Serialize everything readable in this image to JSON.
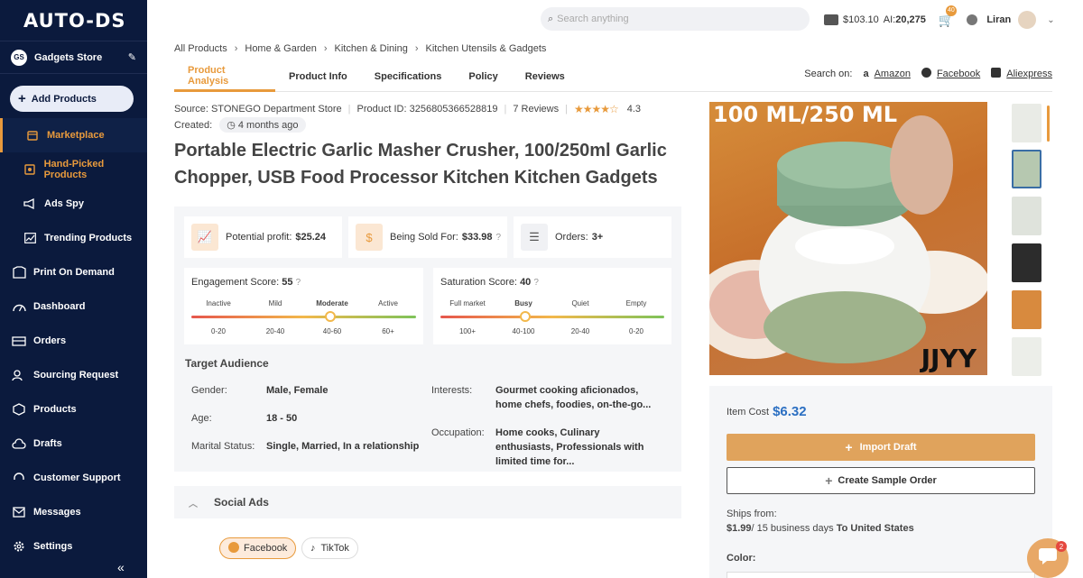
{
  "sidebar": {
    "logo": "AUTO-DS",
    "store_initials": "GS",
    "store_name": "Gadgets Store",
    "add_products": "Add Products",
    "items": [
      {
        "label": "Marketplace",
        "icon": "marketplace-icon",
        "active": true
      },
      {
        "label": "Hand-Picked Products",
        "icon": "hand-picked-icon"
      },
      {
        "label": "Ads Spy",
        "icon": "megaphone-icon"
      },
      {
        "label": "Trending Products",
        "icon": "trend-icon"
      },
      {
        "label": "Print On Demand",
        "icon": "print-icon"
      },
      {
        "label": "Dashboard",
        "icon": "dashboard-icon"
      },
      {
        "label": "Orders",
        "icon": "orders-icon"
      },
      {
        "label": "Sourcing Request",
        "icon": "sourcing-icon"
      },
      {
        "label": "Products",
        "icon": "box-icon"
      },
      {
        "label": "Drafts",
        "icon": "cloud-icon"
      },
      {
        "label": "Customer Support",
        "icon": "headset-icon"
      },
      {
        "label": "Messages",
        "icon": "mail-icon"
      },
      {
        "label": "Settings",
        "icon": "gear-icon"
      }
    ],
    "collapse": "«"
  },
  "topbar": {
    "search_placeholder": "Search anything",
    "balance": "$103.10",
    "ai_label": "AI:",
    "ai_credits": "20,275",
    "cart_badge": "40",
    "user": "Liran"
  },
  "breadcrumb": [
    "All Products",
    "Home & Garden",
    "Kitchen & Dining",
    "Kitchen Utensils & Gadgets"
  ],
  "tabs": [
    "Product Analysis",
    "Product Info",
    "Specifications",
    "Policy",
    "Reviews"
  ],
  "search_on": {
    "label": "Search on:",
    "links": [
      "Amazon",
      "Facebook",
      "Aliexpress"
    ]
  },
  "product": {
    "source": "Source: STONEGO Department Store",
    "product_id": "Product ID: 3256805366528819",
    "reviews": "7 Reviews",
    "stars": "★★★★☆",
    "rating": "4.3",
    "created_label": "Created:",
    "created_value": "4 months ago",
    "title": "Portable Electric Garlic Masher Crusher, 100/250ml Garlic Chopper, USB Food Processor Kitchen Kitchen Gadgets"
  },
  "stats": {
    "profit_label": "Potential profit:",
    "profit_value": "$25.24",
    "sold_label": "Being Sold For:",
    "sold_value": "$33.98",
    "orders_label": "Orders:",
    "orders_value": "3+"
  },
  "engagement": {
    "label": "Engagement Score:",
    "value": "55",
    "levels": [
      "Inactive",
      "Mild",
      "Moderate",
      "Active"
    ],
    "ranges": [
      "0-20",
      "20-40",
      "40-60",
      "60+"
    ],
    "position": 0.62
  },
  "saturation": {
    "label": "Saturation Score:",
    "value": "40",
    "levels": [
      "Full market",
      "Busy",
      "Quiet",
      "Empty"
    ],
    "ranges": [
      "100+",
      "40-100",
      "20-40",
      "0-20"
    ],
    "position": 0.38
  },
  "audience": {
    "title": "Target Audience",
    "gender_label": "Gender:",
    "gender": "Male, Female",
    "age_label": "Age:",
    "age": "18 - 50",
    "marital_label": "Marital Status:",
    "marital": "Single, Married, In a relationship",
    "interests_label": "Interests:",
    "interests": "Gourmet cooking aficionados, home chefs, foodies, on-the-go...",
    "occupation_label": "Occupation:",
    "occupation": "Home cooks, Culinary enthusiasts, Professionals with limited time for..."
  },
  "social": {
    "title": "Social Ads",
    "facebook": "Facebook",
    "tiktok": "TikTok"
  },
  "gallery": {
    "overlay_text": "100 ML/250 ML",
    "brand": "JJYY"
  },
  "buy": {
    "cost_label": "Item Cost",
    "cost": "$6.32",
    "import": "Import Draft",
    "sample": "Create Sample Order",
    "ships_from": "Ships from:",
    "ship_price": "$1.99",
    "ship_days": "/ 15 business days",
    "ship_dest": "To United States",
    "color_label": "Color:"
  },
  "chat_badge": "2",
  "colors": {
    "sidebar": "#0b1a3d",
    "accent": "#e89a3c",
    "link": "#2b6fc2"
  }
}
